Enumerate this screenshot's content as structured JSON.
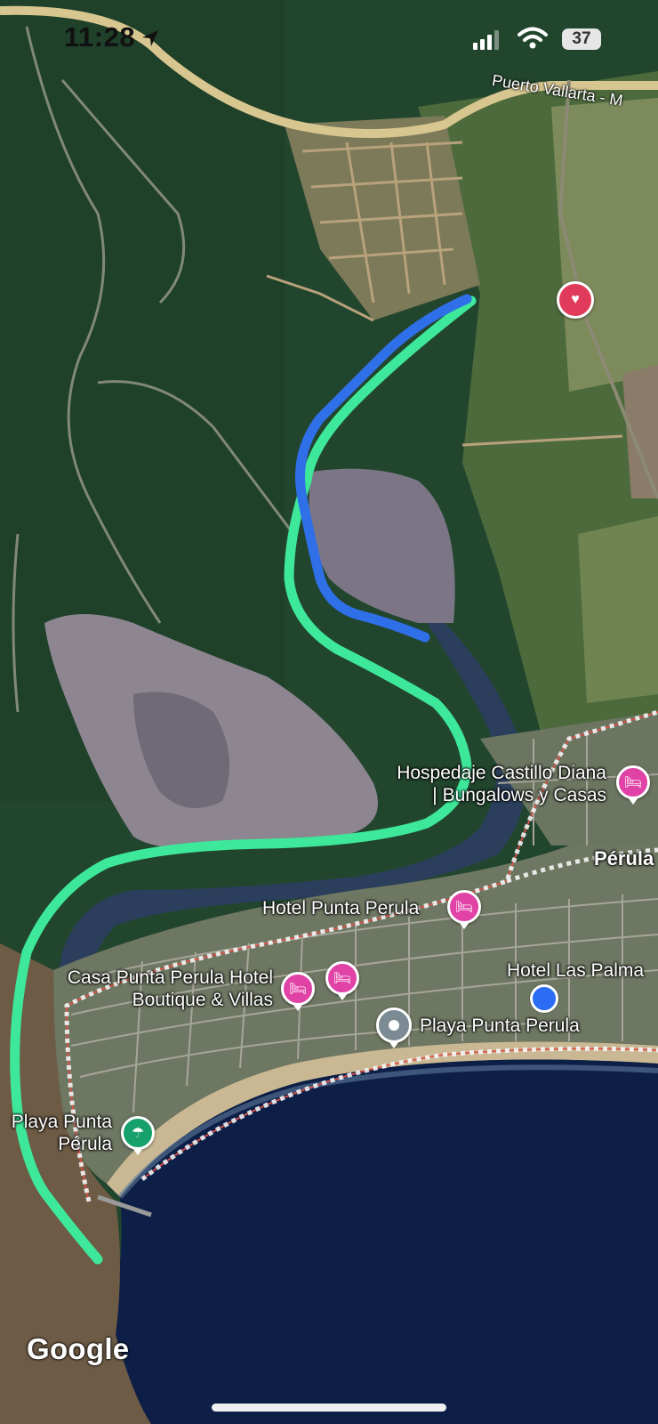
{
  "status_bar": {
    "time": "11:28",
    "battery": "37"
  },
  "map": {
    "road_label": "Puerto Vallarta - M",
    "places": {
      "hospedaje": {
        "line1": "Hospedaje Castillo Diana",
        "line2": "| Bungalows y Casas",
        "icon": "bed-icon"
      },
      "town": {
        "name": "Pérula"
      },
      "hotel_punta_perula": {
        "name": "Hotel Punta Perula",
        "icon": "bed-icon"
      },
      "casa_punta_perula": {
        "line1": "Casa Punta Perula Hotel",
        "line2": "Boutique & Villas",
        "icon": "bed-icon"
      },
      "hotel_las_palmas": {
        "name": "Hotel Las Palma"
      },
      "playa_punta_perula_main": {
        "name": "Playa Punta Perula"
      },
      "playa_punta_perula_beach": {
        "line1": "Playa Punta",
        "line2": "Pérula",
        "icon": "umbrella-icon"
      },
      "favorite": {
        "icon": "heart-icon"
      }
    },
    "routes": [
      {
        "name": "",
        "color": "#2f6fe8"
      },
      {
        "name": "",
        "color": "#3ee89a"
      }
    ],
    "colors": {
      "hotel_pin": "#e042a6",
      "favorite_pin": "#e03b5a",
      "beach_pin": "#16a06b",
      "location_dot": "#2a6df4"
    }
  },
  "attribution": {
    "logo": "Google"
  }
}
